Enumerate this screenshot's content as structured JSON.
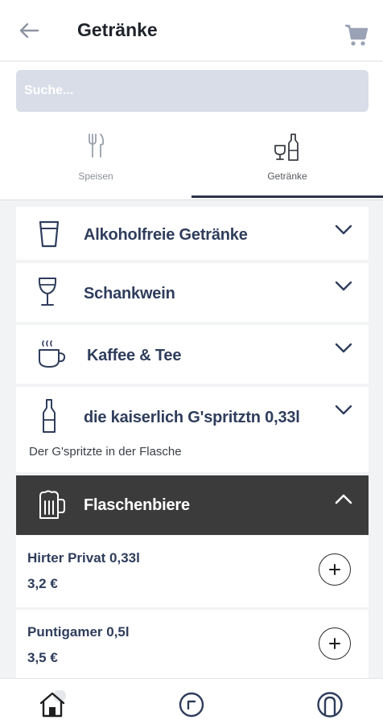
{
  "header": {
    "title": "Getränke"
  },
  "search": {
    "placeholder": "Suche..."
  },
  "tabs": [
    {
      "label": "Speisen",
      "icon": "cutlery-icon",
      "active": false
    },
    {
      "label": "Getränke",
      "icon": "drinks-icon",
      "active": true
    }
  ],
  "categories": [
    {
      "label": "Alkoholfreie Getränke",
      "icon": "glass-icon",
      "expanded": false
    },
    {
      "label": "Schankwein",
      "icon": "wine-glass-icon",
      "expanded": false
    },
    {
      "label": "Kaffee & Tee",
      "icon": "coffee-cup-icon",
      "expanded": false
    },
    {
      "label": "die kaiserlich G'spritztn 0,33l",
      "icon": "bottle-icon",
      "expanded": false,
      "subtitle": "Der G'spritzte in der Flasche"
    },
    {
      "label": "Flaschenbiere",
      "icon": "beer-mug-icon",
      "expanded": true
    }
  ],
  "items": [
    {
      "name": "Hirter Privat 0,33l",
      "price": "3,2 €"
    },
    {
      "name": "Puntigamer 0,5l",
      "price": "3,5 €"
    }
  ],
  "bottom_nav": [
    {
      "icon": "home-icon"
    },
    {
      "icon": "history-icon"
    },
    {
      "icon": "account-icon"
    }
  ],
  "colors": {
    "primary": "#2f3d5c",
    "open_category": "#3b3b3b",
    "search_bg": "#d8dde8"
  }
}
